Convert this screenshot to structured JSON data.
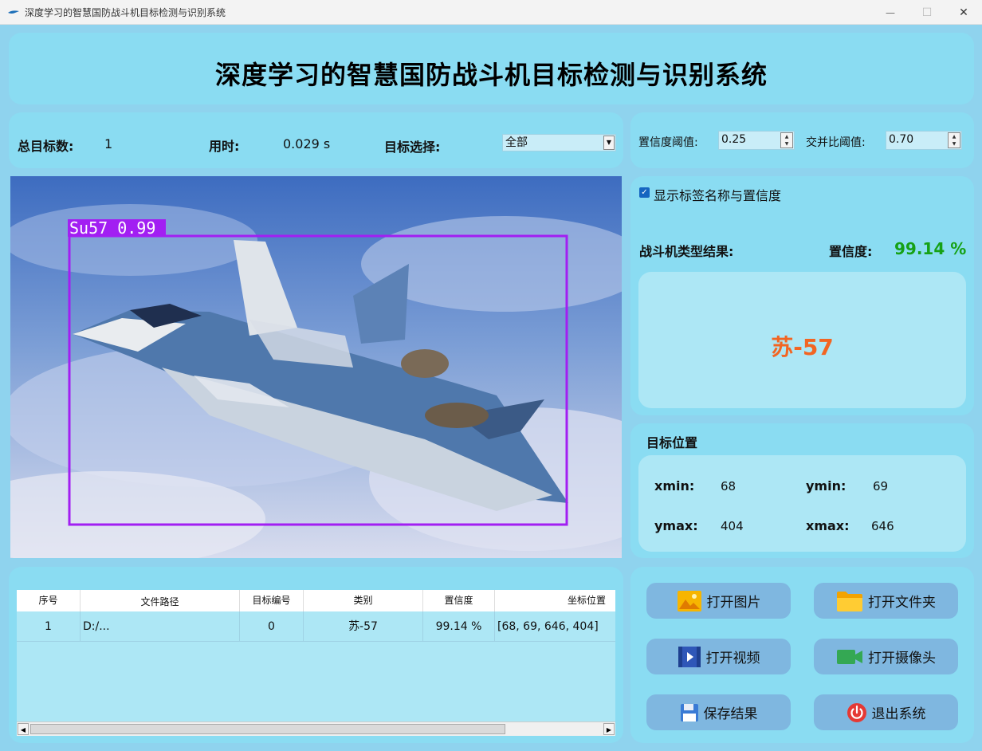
{
  "window": {
    "title": "深度学习的智慧国防战斗机目标检测与识别系统",
    "min_glyph": "—",
    "max_glyph": "☐",
    "close_glyph": "✕"
  },
  "header": {
    "title": "深度学习的智慧国防战斗机目标检测与识别系统"
  },
  "stats": {
    "total_label": "总目标数:",
    "total_value": "1",
    "time_label": "用时:",
    "time_value": "0.029 s",
    "target_label": "目标选择:",
    "target_selected": "全部"
  },
  "thresholds": {
    "conf_label": "置信度阈值:",
    "conf_value": "0.25",
    "iou_label": "交并比阈值:",
    "iou_value": "0.70"
  },
  "detection": {
    "box_label": "Su57  0.99",
    "box_color": "#a21ff2"
  },
  "result": {
    "show_labels_text": "显示标签名称与置信度",
    "type_label": "战斗机类型结果:",
    "conf_label": "置信度:",
    "conf_value": "99.14 %",
    "class_name": "苏-57"
  },
  "position": {
    "title": "目标位置",
    "xmin_label": "xmin:",
    "xmin_value": "68",
    "ymin_label": "ymin:",
    "ymin_value": "69",
    "ymax_label": "ymax:",
    "ymax_value": "404",
    "xmax_label": "xmax:",
    "xmax_value": "646"
  },
  "table": {
    "headers": [
      "序号",
      "文件路径",
      "目标编号",
      "类别",
      "置信度",
      "坐标位置"
    ],
    "rows": [
      [
        "1",
        "D:/...",
        "0",
        "苏-57",
        "99.14 %",
        "[68, 69, 646, 404]"
      ]
    ]
  },
  "buttons": {
    "open_image": "打开图片",
    "open_folder": "打开文件夹",
    "open_video": "打开视频",
    "open_camera": "打开摄像头",
    "save_results": "保存结果",
    "exit_system": "退出系统"
  },
  "colors": {
    "confidence_green": "#16a116",
    "class_orange": "#f26522",
    "panel": "#8adcf2",
    "inner_panel": "#ade7f5",
    "button": "#7fb7e0"
  }
}
